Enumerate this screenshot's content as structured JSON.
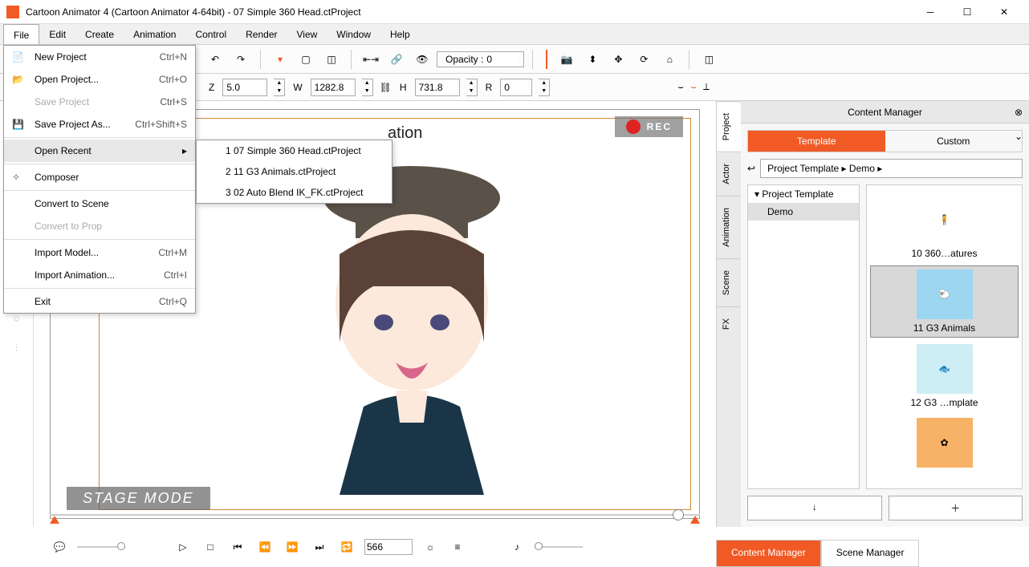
{
  "window": {
    "title": "Cartoon Animator 4  (Cartoon Animator 4-64bit) - 07 Simple 360 Head.ctProject"
  },
  "menu": {
    "items": [
      "File",
      "Edit",
      "Create",
      "Animation",
      "Control",
      "Render",
      "View",
      "Window",
      "Help"
    ],
    "active": "File"
  },
  "file_menu": {
    "new": "New Project",
    "new_sc": "Ctrl+N",
    "open": "Open Project...",
    "open_sc": "Ctrl+O",
    "save": "Save Project",
    "save_sc": "Ctrl+S",
    "saveas": "Save Project As...",
    "saveas_sc": "Ctrl+Shift+S",
    "recent": "Open Recent",
    "composer": "Composer",
    "convert_scene": "Convert to Scene",
    "convert_prop": "Convert to Prop",
    "import_model": "Import Model...",
    "import_model_sc": "Ctrl+M",
    "import_anim": "Import Animation...",
    "import_anim_sc": "Ctrl+I",
    "exit": "Exit",
    "exit_sc": "Ctrl+Q"
  },
  "recent": {
    "r1": "1 07 Simple 360 Head.ctProject",
    "r2": "2 11 G3 Animals.ctProject",
    "r3": "3 02 Auto Blend IK_FK.ctProject"
  },
  "toolbar": {
    "opacity_label": "Opacity :",
    "opacity_value": "0"
  },
  "props": {
    "z": "5.0",
    "w": "1282.8",
    "h": "731.8",
    "r": "0",
    "z_lbl": "Z",
    "w_lbl": "W",
    "h_lbl": "H",
    "r_lbl": "R"
  },
  "stage": {
    "rec": "REC",
    "mode": "STAGE MODE",
    "label": "ation"
  },
  "content_manager": {
    "title": "Content Manager",
    "tab_template": "Template",
    "tab_custom": "Custom",
    "breadcrumb": "Project Template ▸ Demo ▸",
    "tree_root": "▾ Project Template",
    "tree_child": "Demo",
    "thumbs": {
      "t1": "10 360…atures",
      "t2": "11 G3 Animals",
      "t3": "12 G3 …mplate"
    },
    "vtabs": {
      "project": "Project",
      "actor": "Actor",
      "animation": "Animation",
      "scene": "Scene",
      "fx": "FX"
    }
  },
  "bottom_tabs": {
    "content": "Content Manager",
    "scene": "Scene Manager"
  },
  "timeline": {
    "frame": "566"
  }
}
